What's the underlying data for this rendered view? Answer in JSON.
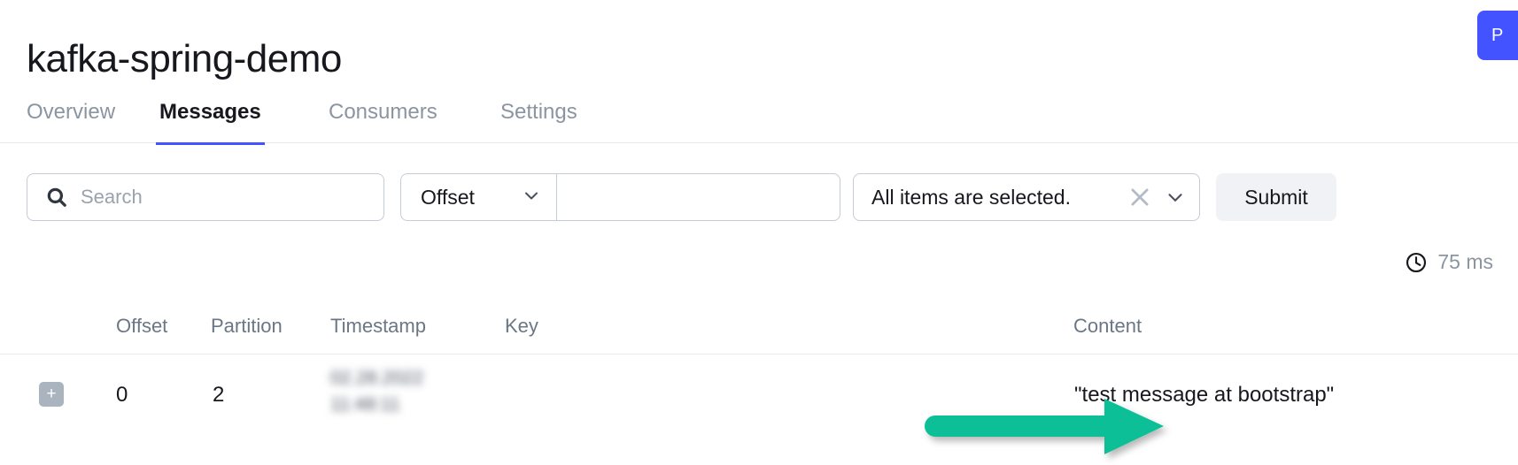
{
  "header": {
    "title": "kafka-spring-demo",
    "primary_button_label": "P",
    "primary_button_color": "#4353ff"
  },
  "tabs": [
    {
      "label": "Overview",
      "active": false
    },
    {
      "label": "Messages",
      "active": true
    },
    {
      "label": "Consumers",
      "active": false
    },
    {
      "label": "Settings",
      "active": false
    }
  ],
  "toolbar": {
    "search_placeholder": "Search",
    "search_value": "",
    "search_icon": "search-icon",
    "offset_select_value": "Offset",
    "offset_caret_icon": "chevron-down-icon",
    "value_input_value": "",
    "value_input_placeholder": "",
    "multiselect_label": "All items are selected.",
    "multiselect_clear_icon": "close-icon",
    "multiselect_caret_icon": "chevron-down-icon",
    "submit_label": "Submit"
  },
  "timing": {
    "icon": "clock-icon",
    "text": "75 ms"
  },
  "table": {
    "columns": {
      "offset": "Offset",
      "partition": "Partition",
      "timestamp": "Timestamp",
      "key": "Key",
      "content": "Content"
    },
    "rows": [
      {
        "expand_label": "+",
        "offset": "0",
        "partition": "2",
        "timestamp_line1": "02.28.2022",
        "timestamp_line2": "11:48:11",
        "key": "",
        "content": "\"test message at bootstrap\""
      }
    ]
  },
  "annotation": {
    "arrow_color": "#0fbf96",
    "arrow_direction": "right"
  }
}
